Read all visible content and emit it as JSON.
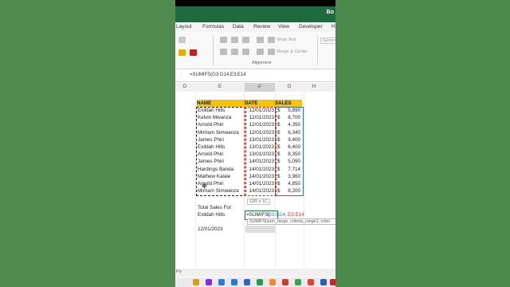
{
  "window": {
    "title": "Bo"
  },
  "ribbon_tabs": [
    "Layout",
    "Formulas",
    "Data",
    "Review",
    "View",
    "Developer",
    "H"
  ],
  "ribbon": {
    "wrap_text": "Wrap Text",
    "merge_center": "Merge & Center",
    "alignment_label": "Alignment",
    "number_format": "General"
  },
  "formula_bar": {
    "formula": "=SUMIFS(G3:G14,E3:E14"
  },
  "columns": [
    "D",
    "E",
    "F",
    "G",
    "H"
  ],
  "table": {
    "headers": {
      "name": "NAME",
      "date": "DATE",
      "sales": "SALES"
    },
    "rows": [
      {
        "name": "Exildah Hills",
        "date": "12/01/2023",
        "currency": "$",
        "sales": "5,890"
      },
      {
        "name": "Kelvin Mwanza",
        "date": "12/01/2023",
        "currency": "$",
        "sales": "8,700"
      },
      {
        "name": "Arnold Phiri",
        "date": "12/01/2023",
        "currency": "$",
        "sales": "4,350"
      },
      {
        "name": "Mirriam Simwanza",
        "date": "12/01/2023",
        "currency": "$",
        "sales": "6,340"
      },
      {
        "name": "James Phiri",
        "date": "13/01/2023",
        "currency": "$",
        "sales": "9,400"
      },
      {
        "name": "Exildah Hills",
        "date": "13/01/2023",
        "currency": "$",
        "sales": "6,400"
      },
      {
        "name": "Arnold Phiri",
        "date": "13/01/2023",
        "currency": "$",
        "sales": "8,350"
      },
      {
        "name": "James Phiri",
        "date": "14/01/2023",
        "currency": "$",
        "sales": "5,090"
      },
      {
        "name": "Hardings Banda",
        "date": "14/01/2023",
        "currency": "$",
        "sales": "7,714"
      },
      {
        "name": "Mathew Kalale",
        "date": "14/01/2023",
        "currency": "$",
        "sales": "3,960"
      },
      {
        "name": "Arnold Phiri",
        "date": "14/01/2023",
        "currency": "$",
        "sales": "4,850"
      },
      {
        "name": "Mirriam Simwanza",
        "date": "14/01/2023",
        "currency": "$",
        "sales": "8,200"
      }
    ]
  },
  "range_tooltip": "12R x 1C",
  "total_label": "Total Sales For:",
  "criteria_name": "Exildah Hills",
  "criteria_date": "12/01/2023",
  "editing_cell": {
    "prefix": "=SUMIFS(",
    "range1": "G3:G14",
    "sep": ",",
    "range2": "E3:E14"
  },
  "fn_tooltip": "SUMIFS(sum_range, criteria_range1, criter",
  "status_text": "Po",
  "colors": {
    "header_fill": "#f6c400",
    "excel_green": "#1e6b3e",
    "range_blue": "#3a6fc4",
    "range_red": "#c0392b"
  }
}
